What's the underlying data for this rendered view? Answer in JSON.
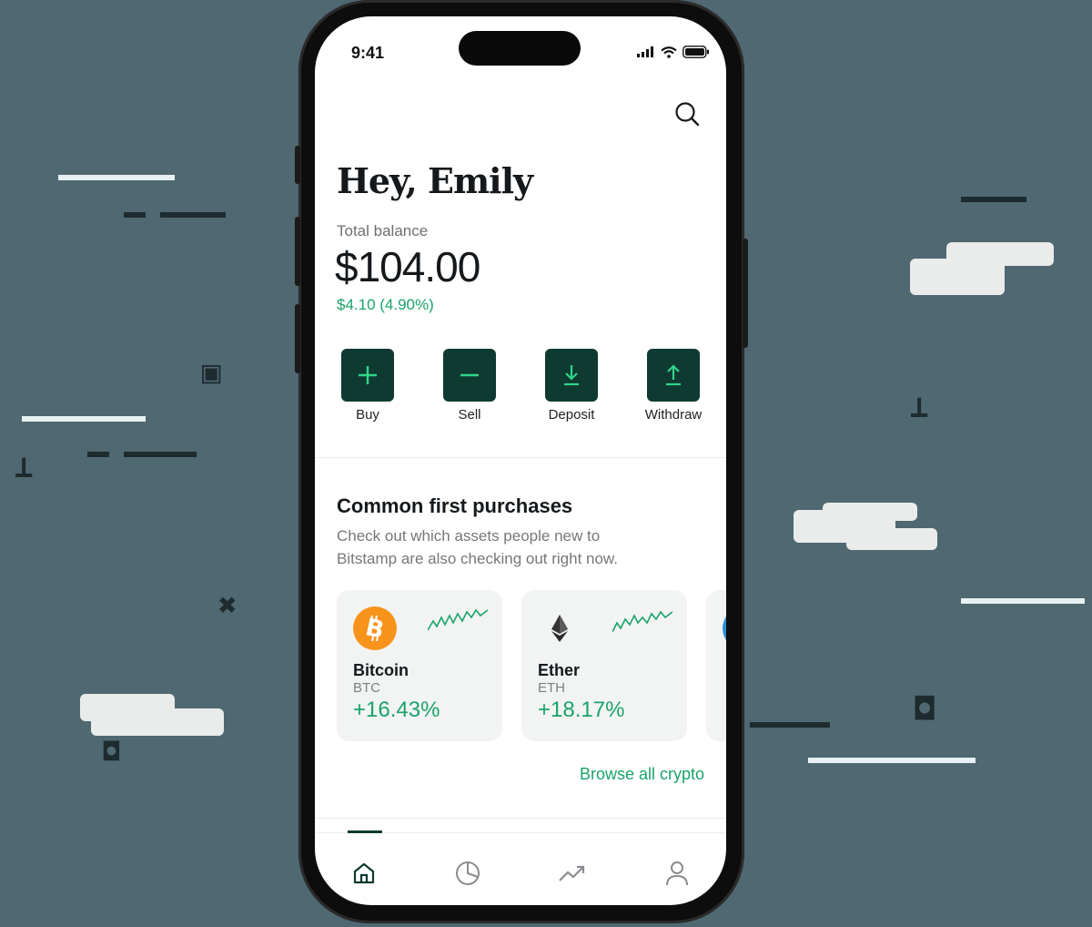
{
  "colors": {
    "background": "#4f6872",
    "accent_dark": "#0f3a31",
    "positive": "#1aa36b",
    "action_icon": "#2fd68a"
  },
  "status_bar": {
    "time": "9:41",
    "icons": [
      "signal-icon",
      "wifi-icon",
      "battery-icon"
    ]
  },
  "header": {
    "search_icon": "search-icon",
    "greeting": "Hey, Emily"
  },
  "balance": {
    "label": "Total balance",
    "value": "$104.00",
    "change": "$4.10 (4.90%)"
  },
  "actions": [
    {
      "label": "Buy",
      "icon": "plus-icon"
    },
    {
      "label": "Sell",
      "icon": "minus-icon"
    },
    {
      "label": "Deposit",
      "icon": "arrow-down-icon"
    },
    {
      "label": "Withdraw",
      "icon": "arrow-up-icon"
    }
  ],
  "section": {
    "title": "Common first purchases",
    "description": "Check out which assets people new to Bitstamp are also checking out right now."
  },
  "assets": [
    {
      "name": "Bitcoin",
      "symbol": "BTC",
      "change": "+16.43%",
      "icon": "bitcoin-icon",
      "color": "#f7931a"
    },
    {
      "name": "Ether",
      "symbol": "ETH",
      "change": "+18.17%",
      "icon": "ethereum-icon",
      "color": "#f2f3f3"
    },
    {
      "name": "",
      "symbol": "",
      "change": "",
      "icon": "coin-icon",
      "color": "#2b8fd6"
    }
  ],
  "browse_link": "Browse all crypto",
  "tabbar": {
    "tabs": [
      "home-icon",
      "portfolio-icon",
      "markets-icon",
      "profile-icon"
    ],
    "active": "home-icon"
  }
}
